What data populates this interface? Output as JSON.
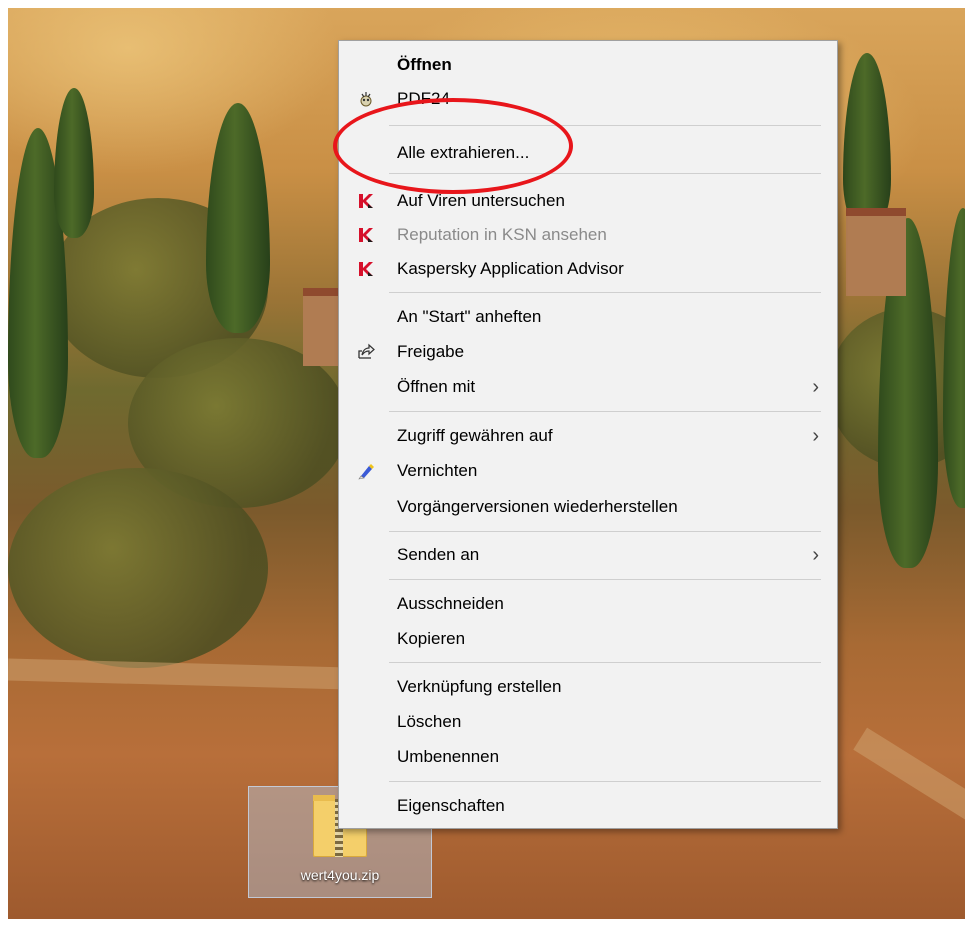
{
  "desktop": {
    "file_name": "wert4you.zip"
  },
  "menu": {
    "items": [
      {
        "label": "Öffnen",
        "icon": null
      },
      {
        "label": "PDF24",
        "icon": "pdf24-icon"
      },
      {
        "label": "Alle extrahieren...",
        "icon": null
      },
      {
        "label": "Auf Viren untersuchen",
        "icon": "kaspersky-icon"
      },
      {
        "label": "Reputation in KSN ansehen",
        "icon": "kaspersky-icon"
      },
      {
        "label": "Kaspersky Application Advisor",
        "icon": "kaspersky-icon"
      },
      {
        "label": "An \"Start\" anheften",
        "icon": null
      },
      {
        "label": "Freigabe",
        "icon": "share-icon"
      },
      {
        "label": "Öffnen mit",
        "icon": null
      },
      {
        "label": "Zugriff gewähren auf",
        "icon": null
      },
      {
        "label": "Vernichten",
        "icon": "shredder-icon"
      },
      {
        "label": "Vorgängerversionen wiederherstellen",
        "icon": null
      },
      {
        "label": "Senden an",
        "icon": null
      },
      {
        "label": "Ausschneiden",
        "icon": null
      },
      {
        "label": "Kopieren",
        "icon": null
      },
      {
        "label": "Verknüpfung erstellen",
        "icon": null
      },
      {
        "label": "Löschen",
        "icon": null
      },
      {
        "label": "Umbenennen",
        "icon": null
      },
      {
        "label": "Eigenschaften",
        "icon": null
      }
    ],
    "submenu_arrow": "›"
  },
  "colors": {
    "highlight_ring": "#e8161b",
    "kaspersky_red": "#d6102b",
    "menu_background": "#f2f2f2"
  }
}
